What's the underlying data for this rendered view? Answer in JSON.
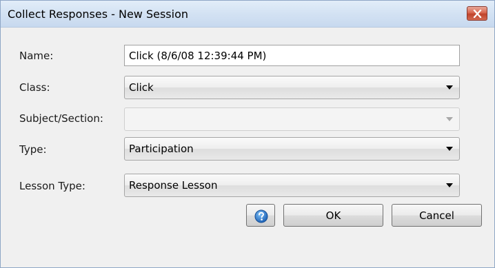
{
  "window": {
    "title": "Collect Responses - New Session"
  },
  "form": {
    "name_label": "Name:",
    "name_value": "Click (8/6/08 12:39:44 PM)",
    "class_label": "Class:",
    "class_value": "Click",
    "subject_label": "Subject/Section:",
    "subject_value": "",
    "type_label": "Type:",
    "type_value": "Participation",
    "lesson_type_label": "Lesson Type:",
    "lesson_type_value": "Response Lesson"
  },
  "buttons": {
    "help_icon": "question-icon",
    "ok_label": "OK",
    "cancel_label": "Cancel"
  },
  "colors": {
    "titlebar": "#d3e2f3",
    "close_button": "#c0432b",
    "help_icon": "#2a7bd6"
  }
}
